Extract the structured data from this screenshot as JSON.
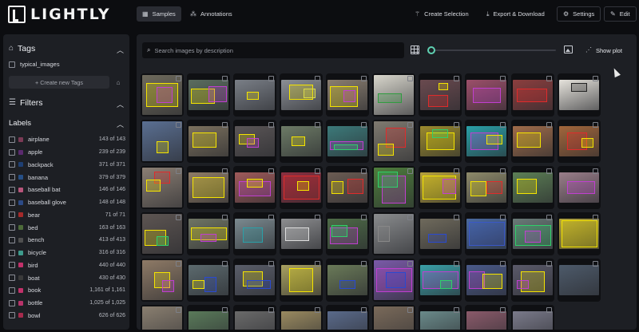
{
  "app": {
    "name": "LIGHTLY"
  },
  "nav": {
    "samples": "Samples",
    "annotations": "Annotations",
    "create_selection": "Create Selection",
    "export_download": "Export & Download",
    "settings": "Settings",
    "edit": "Edit"
  },
  "sidebar": {
    "tags_title": "Tags",
    "tags": [
      {
        "label": "typical_images"
      }
    ],
    "create_tag": "+ Create new Tags",
    "filters_title": "Filters",
    "labels_title": "Labels",
    "labels": [
      {
        "name": "airplane",
        "count": "143 of 143",
        "color": "#7b3a55"
      },
      {
        "name": "apple",
        "count": "239 of 239",
        "color": "#5a2a6e"
      },
      {
        "name": "backpack",
        "count": "371 of 371",
        "color": "#1e3f73"
      },
      {
        "name": "banana",
        "count": "379 of 379",
        "color": "#264f86"
      },
      {
        "name": "baseball bat",
        "count": "146 of 146",
        "color": "#b8557b"
      },
      {
        "name": "baseball glove",
        "count": "148 of 148",
        "color": "#2c4a86"
      },
      {
        "name": "bear",
        "count": "71 of 71",
        "color": "#a52a2a"
      },
      {
        "name": "bed",
        "count": "163 of 163",
        "color": "#4d6b39"
      },
      {
        "name": "bench",
        "count": "413 of 413",
        "color": "#4f4f4f"
      },
      {
        "name": "bicycle",
        "count": "316 of 316",
        "color": "#3e9b8c"
      },
      {
        "name": "bird",
        "count": "440 of 440",
        "color": "#c2316a"
      },
      {
        "name": "boat",
        "count": "430 of 430",
        "color": "#3a3a3a"
      },
      {
        "name": "book",
        "count": "1,161 of 1,161",
        "color": "#c2316a"
      },
      {
        "name": "bottle",
        "count": "1,025 of 1,025",
        "color": "#b8336a"
      },
      {
        "name": "bowl",
        "count": "626 of 626",
        "color": "#a62b4d"
      }
    ]
  },
  "main": {
    "search_placeholder": "Search images by description",
    "show_plot": "Show plot",
    "zoom_level": 0
  },
  "icons": {
    "samples": "grid-icon",
    "annotations": "nodes-icon",
    "create_selection": "wand-icon",
    "export": "download-icon",
    "settings": "gear-icon",
    "edit": "pencil-icon",
    "tags": "tag-icon",
    "filters": "sliders-icon",
    "image": "image-icon",
    "plot": "scatter-icon"
  },
  "colors": {
    "accent": "#5fd1b2",
    "background": "#0c0d10",
    "panel": "#1d1f24"
  },
  "thumbnails": [
    {
      "bg": "#6e6a5c",
      "boxes": [
        [
          "#f5e400",
          0.1,
          0.2,
          0.8,
          0.6
        ],
        [
          "#c03fd0",
          0.35,
          0.3,
          0.4,
          0.4
        ]
      ]
    },
    {
      "bg": "#5b6d5f",
      "boxes": [
        [
          "#f5e400",
          0.05,
          0.3,
          0.6,
          0.5
        ],
        [
          "#c03fd0",
          0.5,
          0.2,
          0.45,
          0.55
        ]
      ]
    },
    {
      "bg": "#7a7f87",
      "boxes": [
        [
          "#f5e400",
          0.3,
          0.4,
          0.3,
          0.25
        ]
      ]
    },
    {
      "bg": "#8b8f95",
      "boxes": [
        [
          "#f5e400",
          0.2,
          0.15,
          0.6,
          0.5
        ],
        [
          "#d9d94a",
          0.55,
          0.3,
          0.3,
          0.3
        ]
      ]
    },
    {
      "bg": "#8a7e70",
      "boxes": [
        [
          "#f5e400",
          0.05,
          0.2,
          0.7,
          0.7
        ],
        [
          "#c03fd0",
          0.4,
          0.35,
          0.3,
          0.4
        ]
      ]
    },
    {
      "bg": "#d8d6cc",
      "boxes": [
        [
          "#2f9c3f",
          0.1,
          0.45,
          0.6,
          0.25
        ]
      ]
    },
    {
      "bg": "#6a4a4f",
      "boxes": [
        [
          "#e02b2b",
          0.2,
          0.5,
          0.5,
          0.4
        ],
        [
          "#f5e400",
          0.45,
          0.1,
          0.25,
          0.25
        ]
      ]
    },
    {
      "bg": "#9c4f6a",
      "boxes": [
        [
          "#c03fd0",
          0.15,
          0.25,
          0.7,
          0.5
        ]
      ]
    },
    {
      "bg": "#8c3e3e",
      "boxes": [
        [
          "#e02b2b",
          0.1,
          0.3,
          0.75,
          0.45
        ]
      ]
    },
    {
      "bg": "#e6e3dc",
      "boxes": [
        [
          "#222222",
          0.3,
          0.1,
          0.4,
          0.3
        ]
      ]
    },
    {
      "bg": "#5a6f92",
      "boxes": [
        [
          "#f5e400",
          0.35,
          0.5,
          0.3,
          0.3
        ]
      ]
    },
    {
      "bg": "#7c715e",
      "boxes": [
        [
          "#f5e400",
          0.1,
          0.2,
          0.6,
          0.5
        ]
      ]
    },
    {
      "bg": "#5b5657",
      "boxes": [
        [
          "#f5e400",
          0.1,
          0.25,
          0.4,
          0.35
        ],
        [
          "#c03fd0",
          0.3,
          0.4,
          0.3,
          0.3
        ]
      ]
    },
    {
      "bg": "#6d7b66",
      "boxes": [
        [
          "#f5e400",
          0.25,
          0.35,
          0.35,
          0.3
        ]
      ]
    },
    {
      "bg": "#3c7a7a",
      "boxes": [
        [
          "#c03fd0",
          0.05,
          0.5,
          0.85,
          0.3
        ],
        [
          "#2fd06a",
          0.15,
          0.6,
          0.6,
          0.2
        ]
      ]
    },
    {
      "bg": "#7f7a70",
      "boxes": [
        [
          "#e02b2b",
          0.3,
          0.15,
          0.5,
          0.5
        ],
        [
          "#f5e400",
          0.1,
          0.55,
          0.4,
          0.3
        ]
      ]
    },
    {
      "bg": "#9b8a2e",
      "boxes": [
        [
          "#f5e400",
          0.15,
          0.2,
          0.7,
          0.6
        ],
        [
          "#2fd06a",
          0.3,
          0.1,
          0.4,
          0.3
        ]
      ]
    },
    {
      "bg": "#2aa0a8",
      "boxes": [
        [
          "#c03fd0",
          0.1,
          0.2,
          0.7,
          0.6
        ],
        [
          "#f5e400",
          0.5,
          0.3,
          0.4,
          0.3
        ]
      ]
    },
    {
      "bg": "#a06c4a",
      "boxes": [
        [
          "#f5e400",
          0.1,
          0.2,
          0.6,
          0.5
        ]
      ]
    },
    {
      "bg": "#a2663b",
      "boxes": [
        [
          "#e02b2b",
          0.2,
          0.2,
          0.5,
          0.6
        ],
        [
          "#f5e400",
          0.55,
          0.4,
          0.3,
          0.3
        ]
      ]
    },
    {
      "bg": "#8b7f74",
      "boxes": [
        [
          "#e02b2b",
          0.3,
          0.1,
          0.4,
          0.3
        ],
        [
          "#f5e400",
          0.1,
          0.3,
          0.35,
          0.3
        ]
      ]
    },
    {
      "bg": "#8f7c66",
      "boxes": [
        [
          "#f5e400",
          0.1,
          0.15,
          0.8,
          0.7
        ]
      ]
    },
    {
      "bg": "#9f5a5a",
      "boxes": [
        [
          "#c03fd0",
          0.1,
          0.3,
          0.8,
          0.5
        ],
        [
          "#f5e400",
          0.3,
          0.2,
          0.4,
          0.3
        ]
      ]
    },
    {
      "bg": "#8c2f40",
      "boxes": [
        [
          "#e02b2b",
          0.05,
          0.1,
          0.9,
          0.8
        ],
        [
          "#f5e400",
          0.4,
          0.3,
          0.3,
          0.3
        ]
      ]
    },
    {
      "bg": "#6b5c53",
      "boxes": [
        [
          "#f5e400",
          0.1,
          0.3,
          0.3,
          0.4
        ],
        [
          "#e02b2b",
          0.5,
          0.2,
          0.4,
          0.5
        ]
      ]
    },
    {
      "bg": "#4e7d3c",
      "boxes": [
        [
          "#c03fd0",
          0.2,
          0.2,
          0.6,
          0.7
        ],
        [
          "#2fd06a",
          0.1,
          0.1,
          0.5,
          0.4
        ]
      ]
    },
    {
      "bg": "#b8a23c",
      "boxes": [
        [
          "#f5e400",
          0.05,
          0.1,
          0.85,
          0.8
        ],
        [
          "#c03fd0",
          0.55,
          0.2,
          0.35,
          0.5
        ]
      ]
    },
    {
      "bg": "#8e8a6a",
      "boxes": [
        [
          "#f5e400",
          0.1,
          0.3,
          0.4,
          0.5
        ],
        [
          "#e02b2b",
          0.5,
          0.3,
          0.4,
          0.4
        ]
      ]
    },
    {
      "bg": "#5c7f55",
      "boxes": [
        [
          "#f5e400",
          0.1,
          0.2,
          0.5,
          0.5
        ]
      ]
    },
    {
      "bg": "#9a7e8a",
      "boxes": [
        [
          "#c03fd0",
          0.2,
          0.3,
          0.7,
          0.4
        ]
      ]
    },
    {
      "bg": "#5d5552",
      "boxes": [
        [
          "#f5e400",
          0.05,
          0.4,
          0.55,
          0.4
        ],
        [
          "#2fd06a",
          0.35,
          0.55,
          0.3,
          0.25
        ]
      ]
    },
    {
      "bg": "#6f7564",
      "boxes": [
        [
          "#f5e400",
          0.05,
          0.3,
          0.9,
          0.4
        ],
        [
          "#c03fd0",
          0.3,
          0.5,
          0.4,
          0.25
        ]
      ]
    },
    {
      "bg": "#7b8a90",
      "boxes": [
        [
          "#2aa0a8",
          0.2,
          0.3,
          0.5,
          0.5
        ]
      ]
    },
    {
      "bg": "#8d8e90",
      "boxes": [
        [
          "#dddddd",
          0.1,
          0.3,
          0.6,
          0.45
        ]
      ]
    },
    {
      "bg": "#4e6b47",
      "boxes": [
        [
          "#c03fd0",
          0.05,
          0.3,
          0.7,
          0.55
        ],
        [
          "#2fd06a",
          0.1,
          0.2,
          0.4,
          0.4
        ]
      ]
    },
    {
      "bg": "#8a8c8e",
      "boxes": [
        [
          "#888888",
          0.1,
          0.3,
          0.3,
          0.4
        ]
      ]
    },
    {
      "bg": "#6f6a5c",
      "boxes": [
        [
          "#2a4ad0",
          0.2,
          0.5,
          0.45,
          0.3
        ]
      ]
    },
    {
      "bg": "#4a6aa0",
      "boxes": [
        [
          "#3a58c8",
          0.05,
          0.1,
          0.9,
          0.8
        ]
      ]
    },
    {
      "bg": "#6a7a78",
      "boxes": [
        [
          "#2fd06a",
          0.05,
          0.2,
          0.9,
          0.7
        ],
        [
          "#c03fd0",
          0.3,
          0.4,
          0.4,
          0.4
        ]
      ]
    },
    {
      "bg": "#b4a53a",
      "boxes": [
        [
          "#f5e400",
          0.05,
          0.05,
          0.9,
          0.9
        ]
      ]
    },
    {
      "bg": "#8e7a66",
      "boxes": [
        [
          "#f5e400",
          0.3,
          0.3,
          0.4,
          0.4
        ],
        [
          "#c03fd0",
          0.5,
          0.5,
          0.3,
          0.3
        ]
      ]
    },
    {
      "bg": "#5c6a6e",
      "boxes": [
        [
          "#2a4ad0",
          0.4,
          0.4,
          0.3,
          0.5
        ],
        [
          "#f5e400",
          0.1,
          0.5,
          0.3,
          0.3
        ]
      ]
    },
    {
      "bg": "#5a5e6a",
      "boxes": [
        [
          "#f5e400",
          0.2,
          0.2,
          0.5,
          0.5
        ],
        [
          "#2a4ad0",
          0.3,
          0.5,
          0.6,
          0.3
        ]
      ]
    },
    {
      "bg": "#a8a060",
      "boxes": [
        [
          "#f5e400",
          0.2,
          0.1,
          0.6,
          0.8
        ]
      ]
    },
    {
      "bg": "#6a7a58",
      "boxes": [
        [
          "#2a4ad0",
          0.3,
          0.5,
          0.4,
          0.3
        ]
      ]
    },
    {
      "bg": "#7a5aa8",
      "boxes": [
        [
          "#c03fd0",
          0.05,
          0.2,
          0.9,
          0.6
        ],
        [
          "#2a4ad0",
          0.3,
          0.3,
          0.5,
          0.4
        ]
      ]
    },
    {
      "bg": "#3aa0a8",
      "boxes": [
        [
          "#c03fd0",
          0.05,
          0.2,
          0.9,
          0.6
        ],
        [
          "#2fd06a",
          0.5,
          0.5,
          0.3,
          0.3
        ]
      ]
    },
    {
      "bg": "#4a5a8a",
      "boxes": [
        [
          "#c03fd0",
          0.05,
          0.2,
          0.4,
          0.6
        ],
        [
          "#f5e400",
          0.4,
          0.3,
          0.5,
          0.5
        ]
      ]
    },
    {
      "bg": "#5a5a6a",
      "boxes": [
        [
          "#f5e400",
          0.2,
          0.2,
          0.6,
          0.7
        ],
        [
          "#c03fd0",
          0.1,
          0.5,
          0.3,
          0.3
        ]
      ]
    },
    {
      "bg": "#4d5a6a",
      "boxes": []
    },
    {
      "bg": "#8a7f70",
      "boxes": []
    },
    {
      "bg": "#5a7a5a",
      "boxes": []
    },
    {
      "bg": "#6a6a6a",
      "boxes": []
    },
    {
      "bg": "#9a8a60",
      "boxes": []
    },
    {
      "bg": "#5a6a8a",
      "boxes": []
    },
    {
      "bg": "#7a6a5a",
      "boxes": []
    },
    {
      "bg": "#6a8a8a",
      "boxes": []
    },
    {
      "bg": "#8a5a6a",
      "boxes": []
    },
    {
      "bg": "#7a7a8a",
      "boxes": []
    }
  ]
}
